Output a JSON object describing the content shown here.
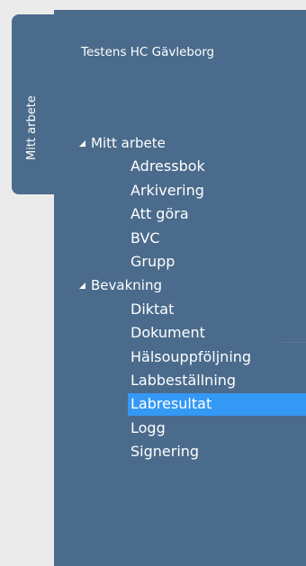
{
  "vertical_tab": {
    "label": "Mitt arbete"
  },
  "organization": "Testens HC Gävleborg",
  "tree": [
    {
      "label": "Mitt arbete",
      "kind": "group",
      "expanded": true
    },
    {
      "label": "Adressbok",
      "kind": "child"
    },
    {
      "label": "Arkivering",
      "kind": "child"
    },
    {
      "label": "Att göra",
      "kind": "child"
    },
    {
      "label": "BVC",
      "kind": "child"
    },
    {
      "label": "Grupp",
      "kind": "child"
    },
    {
      "label": "Bevakning",
      "kind": "group",
      "expanded": true
    },
    {
      "label": "Diktat",
      "kind": "child"
    },
    {
      "label": "Dokument",
      "kind": "child"
    },
    {
      "label": "Hälsouppföljning",
      "kind": "child"
    },
    {
      "label": "Labbeställning",
      "kind": "child"
    },
    {
      "label": "Labresultat",
      "kind": "child",
      "selected": true
    },
    {
      "label": "Logg",
      "kind": "child"
    },
    {
      "label": "Signering",
      "kind": "child"
    }
  ],
  "colors": {
    "panel": "#4a6b8c",
    "selection": "#3498f5",
    "background": "#ebebeb"
  }
}
